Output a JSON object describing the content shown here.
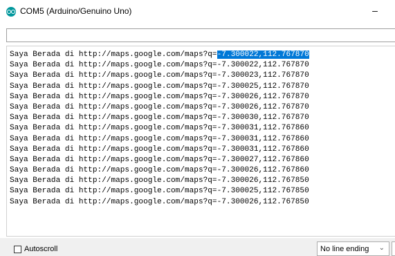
{
  "window": {
    "title": "COM5 (Arduino/Genuino Uno)",
    "app_icon": "arduino-logo-icon",
    "minimize_glyph": "–"
  },
  "send_input": {
    "value": ""
  },
  "output": {
    "lines": [
      {
        "prefix": "Saya Berada di http://maps.google.com/maps?q=",
        "coords": "-7.300022,112.767870",
        "selected": true
      },
      {
        "prefix": "Saya Berada di http://maps.google.com/maps?q=",
        "coords": "-7.300022,112.767870",
        "selected": false
      },
      {
        "prefix": "Saya Berada di http://maps.google.com/maps?q=",
        "coords": "-7.300023,112.767870",
        "selected": false
      },
      {
        "prefix": "Saya Berada di http://maps.google.com/maps?q=",
        "coords": "-7.300025,112.767870",
        "selected": false
      },
      {
        "prefix": "Saya Berada di http://maps.google.com/maps?q=",
        "coords": "-7.300026,112.767870",
        "selected": false
      },
      {
        "prefix": "Saya Berada di http://maps.google.com/maps?q=",
        "coords": "-7.300026,112.767870",
        "selected": false
      },
      {
        "prefix": "Saya Berada di http://maps.google.com/maps?q=",
        "coords": "-7.300030,112.767870",
        "selected": false
      },
      {
        "prefix": "Saya Berada di http://maps.google.com/maps?q=",
        "coords": "-7.300031,112.767860",
        "selected": false
      },
      {
        "prefix": "Saya Berada di http://maps.google.com/maps?q=",
        "coords": "-7.300031,112.767860",
        "selected": false
      },
      {
        "prefix": "Saya Berada di http://maps.google.com/maps?q=",
        "coords": "-7.300031,112.767860",
        "selected": false
      },
      {
        "prefix": "Saya Berada di http://maps.google.com/maps?q=",
        "coords": "-7.300027,112.767860",
        "selected": false
      },
      {
        "prefix": "Saya Berada di http://maps.google.com/maps?q=",
        "coords": "-7.300026,112.767860",
        "selected": false
      },
      {
        "prefix": "Saya Berada di http://maps.google.com/maps?q=",
        "coords": "-7.300026,112.767850",
        "selected": false
      },
      {
        "prefix": "Saya Berada di http://maps.google.com/maps?q=",
        "coords": "-7.300025,112.767850",
        "selected": false
      },
      {
        "prefix": "Saya Berada di http://maps.google.com/maps?q=",
        "coords": "-7.300026,112.767850",
        "selected": false
      }
    ]
  },
  "status_bar": {
    "autoscroll_label": "Autoscroll",
    "autoscroll_checked": false,
    "line_ending": {
      "selected": "No line ending",
      "icon": "chevron-down-icon"
    }
  },
  "colors": {
    "selection": "#0078d7",
    "arduino_teal": "#00979c",
    "status_bar_bg": "#f0f0f0"
  }
}
